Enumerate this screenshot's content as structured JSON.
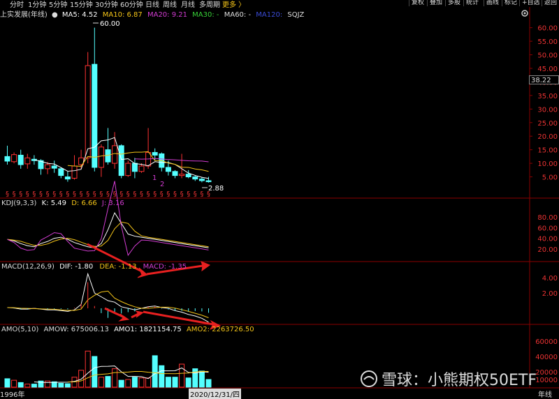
{
  "toolbar": {
    "periods": [
      "分时",
      "1分钟",
      "5分钟",
      "15分钟",
      "30分钟",
      "60分钟",
      "日线",
      "周线",
      "月线",
      "多周期"
    ],
    "more": "更多 〉",
    "right_buttons": [
      "复权",
      "叠加",
      "多股",
      "统计",
      "画线",
      "标记",
      "+自选",
      "返回"
    ]
  },
  "panels": {
    "main": {
      "title": "上实发展(年线)",
      "ma": [
        {
          "label": "MA5: 4.52",
          "color": "#ffffff"
        },
        {
          "label": "MA10: 6.87",
          "color": "#f5c518"
        },
        {
          "label": "MA20: 9.21",
          "color": "#d23cd2"
        },
        {
          "label": "MA30: -",
          "color": "#37d137"
        },
        {
          "label": "MA60: -",
          "color": "#dddddd"
        },
        {
          "label": "MA120: ",
          "color": "#3a4bd6"
        }
      ],
      "extra": "SQJZ",
      "high_label": "60.00",
      "low_label": "2.88",
      "price_box": "38.22",
      "yticks": [
        "60.00",
        "55.00",
        "50.00",
        "45.00",
        "40.00",
        "35.00",
        "30.00",
        "25.00",
        "20.00",
        "15.00",
        "10.00",
        "5.00"
      ],
      "marks": [
        "1",
        "2"
      ]
    },
    "kdj": {
      "title": "KDJ(9,3,3)",
      "k": "K: 5.49",
      "d": "D: 6.66",
      "j": "J: 3.16",
      "yticks": [
        "80.00",
        "60.00",
        "40.00",
        "20.00"
      ]
    },
    "macd": {
      "title": "MACD(12,26,9)",
      "dif": "DIF: -1.80",
      "dea": "DEA: -1.13",
      "macd": "MACD: -1.35",
      "yticks": [
        "4.00",
        "2.00"
      ]
    },
    "amo": {
      "title": "AMO(5,10)",
      "amow": "AMOW: 675006.13",
      "amo1": "AMO1: 1821154.75",
      "amo2": "AMO2: 2263726.50",
      "yticks": [
        "60000",
        "40000",
        "20000",
        "10000"
      ]
    }
  },
  "dateaxis": {
    "start": "1996年",
    "end": "2020/12/31/四",
    "period": "年线"
  },
  "watermark": "雪球：小熊期权50ETF",
  "chart_data": {
    "type": "candlestick",
    "title": "上实发展(年线)",
    "candles": [
      {
        "o": 12.5,
        "c": 10.8,
        "h": 16.5,
        "l": 9.5
      },
      {
        "o": 10.6,
        "c": 13.2,
        "h": 14.0,
        "l": 10.0
      },
      {
        "o": 13.0,
        "c": 9.5,
        "h": 15.0,
        "l": 8.0
      },
      {
        "o": 9.8,
        "c": 12.0,
        "h": 13.5,
        "l": 8.0
      },
      {
        "o": 11.5,
        "c": 11.0,
        "h": 13.0,
        "l": 9.5
      },
      {
        "o": 11.0,
        "c": 8.0,
        "h": 11.5,
        "l": 5.8
      },
      {
        "o": 8.0,
        "c": 9.5,
        "h": 10.5,
        "l": 6.0
      },
      {
        "o": 9.0,
        "c": 8.2,
        "h": 11.0,
        "l": 6.5
      },
      {
        "o": 8.0,
        "c": 5.5,
        "h": 8.5,
        "l": 4.5
      },
      {
        "o": 5.0,
        "c": 4.2,
        "h": 7.0,
        "l": 3.2
      },
      {
        "o": 4.5,
        "c": 9.0,
        "h": 13.0,
        "l": 4.0
      },
      {
        "o": 9.5,
        "c": 12.0,
        "h": 15.0,
        "l": 8.0
      },
      {
        "o": 12.0,
        "c": 46.0,
        "h": 51.0,
        "l": 10.0
      },
      {
        "o": 46.5,
        "c": 8.5,
        "h": 60.0,
        "l": 7.0
      },
      {
        "o": 8.5,
        "c": 16.0,
        "h": 17.0,
        "l": 5.0
      },
      {
        "o": 15.0,
        "c": 10.5,
        "h": 23.0,
        "l": 9.5
      },
      {
        "o": 10.0,
        "c": 16.5,
        "h": 21.5,
        "l": 8.0
      },
      {
        "o": 16.5,
        "c": 5.5,
        "h": 17.0,
        "l": 4.5
      },
      {
        "o": 5.5,
        "c": 10.0,
        "h": 11.0,
        "l": 5.0
      },
      {
        "o": 10.0,
        "c": 7.0,
        "h": 12.0,
        "l": 4.5
      },
      {
        "o": 7.0,
        "c": 9.0,
        "h": 10.0,
        "l": 6.5
      },
      {
        "o": 9.0,
        "c": 14.0,
        "h": 23.0,
        "l": 8.0
      },
      {
        "o": 14.0,
        "c": 13.0,
        "h": 15.5,
        "l": 11.0
      },
      {
        "o": 13.5,
        "c": 8.5,
        "h": 14.0,
        "l": 7.0
      },
      {
        "o": 8.5,
        "c": 7.0,
        "h": 11.0,
        "l": 5.5
      },
      {
        "o": 7.0,
        "c": 5.5,
        "h": 7.5,
        "l": 4.5
      },
      {
        "o": 5.5,
        "c": 6.0,
        "h": 13.5,
        "l": 4.5
      },
      {
        "o": 6.0,
        "c": 5.0,
        "h": 7.5,
        "l": 4.5
      },
      {
        "o": 5.0,
        "c": 4.2,
        "h": 5.5,
        "l": 3.5
      },
      {
        "o": 4.2,
        "c": 3.6,
        "h": 4.8,
        "l": 3.0
      },
      {
        "o": 3.6,
        "c": 3.2,
        "h": 5.0,
        "l": 2.88
      }
    ],
    "ylim": [
      0,
      63
    ],
    "amo": [
      11000,
      9000,
      6000,
      4000,
      4000,
      8000,
      8000,
      7000,
      5000,
      4500,
      13000,
      22000,
      47000,
      40000,
      13000,
      14000,
      24000,
      9000,
      10000,
      13000,
      12000,
      12000,
      41000,
      28000,
      13000,
      13000,
      30000,
      12000,
      24000,
      21000,
      10000
    ],
    "amo_ylim": [
      0,
      70000
    ]
  }
}
